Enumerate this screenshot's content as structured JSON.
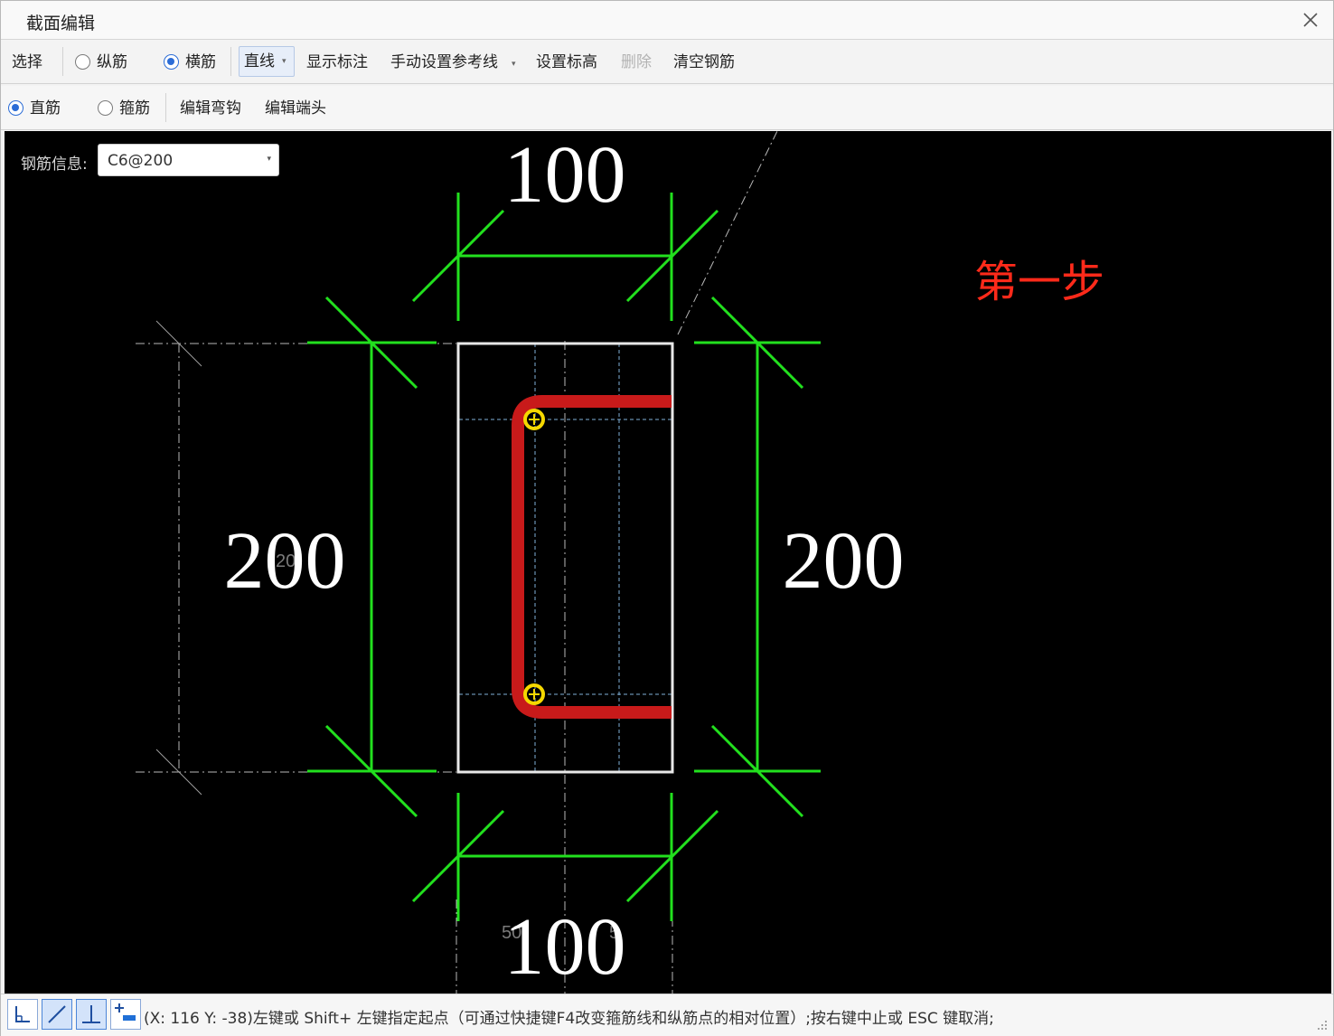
{
  "window": {
    "title": "截面编辑",
    "close_icon": "close-icon"
  },
  "toolbar1": {
    "select": "选择",
    "longitudinal": "纵筋",
    "transverse": "横筋",
    "transverse_checked": true,
    "line_mode": "直线",
    "show_dimension": "显示标注",
    "manual_reference_line": "手动设置参考线",
    "set_elevation": "设置标高",
    "delete": "删除",
    "clear_rebar": "清空钢筋"
  },
  "toolbar2": {
    "straight_bar": "直筋",
    "straight_bar_checked": true,
    "stirrup": "箍筋",
    "edit_hook": "编辑弯钩",
    "edit_end": "编辑端头"
  },
  "canvas": {
    "rebar_info_label": "钢筋信息:",
    "rebar_info_value": "C6@200",
    "annotation": "第一步",
    "dim_top": "100",
    "dim_bottom": "100",
    "dim_left": "200",
    "dim_right": "200",
    "faint_left": "20",
    "faint_bottom_left": "50",
    "faint_bottom_right": "5",
    "colors": {
      "background": "#000000",
      "dimension": "#22e01e",
      "rebar": "#c81a1a",
      "point": "#f5d800",
      "section": "#e8e8e8",
      "annotation": "#ff2a1a"
    }
  },
  "statusbar": {
    "buttons": [
      "orthogonal-icon",
      "line-icon",
      "perpendicular-icon",
      "add-point-icon"
    ],
    "message": "(X: 116 Y: -38)左键或 Shift+ 左键指定起点（可通过快捷键F4改变箍筋线和纵筋点的相对位置）;按右键中止或 ESC 键取消;"
  }
}
